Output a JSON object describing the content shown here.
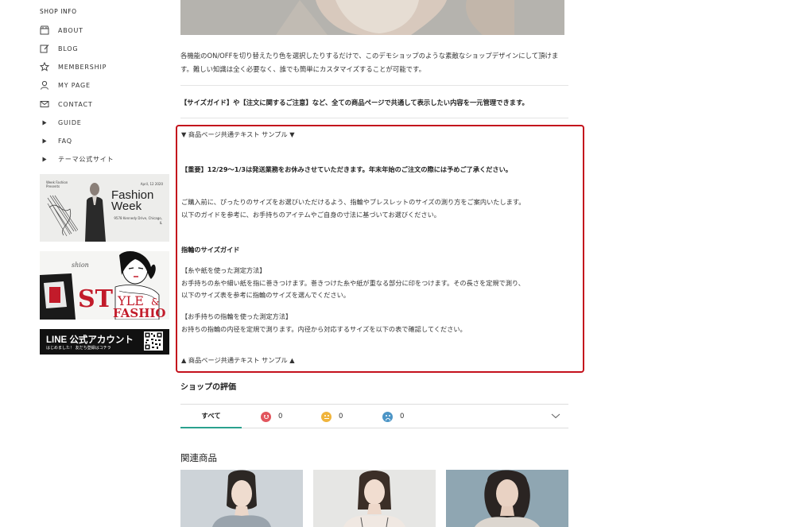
{
  "sidebar": {
    "title": "SHOP INFO",
    "items": [
      {
        "label": "ABOUT",
        "icon": "shop-icon"
      },
      {
        "label": "BLOG",
        "icon": "edit-icon"
      },
      {
        "label": "MEMBERSHIP",
        "icon": "star-icon"
      },
      {
        "label": "MY PAGE",
        "icon": "user-icon"
      },
      {
        "label": "CONTACT",
        "icon": "mail-icon"
      },
      {
        "label": "GUIDE",
        "icon": "caret-right-icon"
      },
      {
        "label": "FAQ",
        "icon": "caret-right-icon"
      },
      {
        "label": "テーマ公式サイト",
        "icon": "caret-right-icon"
      }
    ],
    "banners": {
      "fashion": {
        "corner_left": "Week Fashion Presents",
        "corner_right": "April, 12 2020",
        "title_line1": "Fashion",
        "title_line2": "Week",
        "address": "9578 Kennedy Drive, Chicago, IL"
      },
      "style": {
        "text": "STYLE & FASHION"
      },
      "line": {
        "title": "LINE 公式アカウント",
        "subtitle": "はじめました！ 友だち登録はコチラ"
      }
    }
  },
  "main": {
    "intro_text": "各機能のON/OFFを切り替えたり色を選択したりするだけで、このデモショップのような素敵なショップデザインにして頂けます。難しい知識は全く必要なく、誰でも簡単にカスタマイズすることが可能です。",
    "notice": "【サイズガイド】や【注文に関するご注意】など、全ての商品ページで共通して表示したい内容を一元管理できます。",
    "common_text": {
      "start_marker": "▼ 商品ページ共通テキスト サンプル ▼",
      "important": "【重要】12/29〜1/3は発送業務をお休みさせていただきます。年末年始のご注文の際には予めご了承ください。",
      "guide_line1": "ご購入前に、ぴったりのサイズをお選びいただけるよう、指輪やブレスレットのサイズの測り方をご案内いたします。",
      "guide_line2": "以下のガイドを参考に、お手持ちのアイテムやご自身の寸法に基づいてお選びください。",
      "ring_heading": "指輪のサイズガイド",
      "method1_title": "【糸や紙を使った測定方法】",
      "method1_line1": "お手持ちの糸や細い紙を指に巻きつけます。巻きつけた糸や紙が重なる部分に印をつけます。その長さを定規で測り、",
      "method1_line2": "以下のサイズ表を参考に指輪のサイズを選んでください。",
      "method2_title": "【お手持ちの指輪を使った測定方法】",
      "method2_line1": "お持ちの指輪の内径を定規で測ります。内径から対応するサイズを以下の表で確認してください。",
      "end_marker": "▲ 商品ページ共通テキスト サンプル ▲"
    },
    "evaluation": {
      "title": "ショップの評価",
      "tab_all": "すべて",
      "good_count": "0",
      "neutral_count": "0",
      "bad_count": "0"
    },
    "related": {
      "title": "関連商品"
    }
  },
  "colors": {
    "highlight_border": "#c4121c",
    "active_tab": "#2aa18e",
    "face_good": "#e2555d",
    "face_neutral": "#f0b43c",
    "face_bad": "#4c95c6"
  }
}
